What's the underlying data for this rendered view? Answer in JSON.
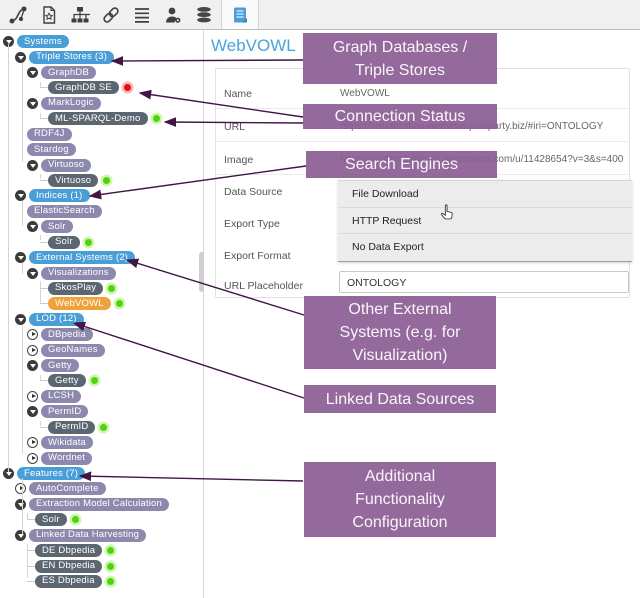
{
  "toolbar": {
    "icons": [
      {
        "name": "route-icon",
        "active": false
      },
      {
        "name": "file-star-icon",
        "active": false
      },
      {
        "name": "sitemap-icon",
        "active": false
      },
      {
        "name": "link-icon",
        "active": false
      },
      {
        "name": "list-icon",
        "active": false
      },
      {
        "name": "user-gear-icon",
        "active": false
      },
      {
        "name": "database-icon",
        "active": false
      },
      {
        "name": "server-blue-icon",
        "active": true
      }
    ]
  },
  "tree": {
    "rows": [
      {
        "label": "Systems",
        "depth": 0,
        "style": "blue",
        "expander": "expanded"
      },
      {
        "label": "Triple Stores (3)",
        "depth": 1,
        "style": "blue",
        "expander": "expanded"
      },
      {
        "label": "GraphDB",
        "depth": 2,
        "style": "purple",
        "expander": "expanded"
      },
      {
        "label": "GraphDB SE",
        "depth": 3,
        "style": "dark",
        "stub": true,
        "status": "red"
      },
      {
        "label": "MarkLogic",
        "depth": 2,
        "style": "purple",
        "expander": "expanded"
      },
      {
        "label": "ML-SPARQL-Demo",
        "depth": 3,
        "style": "dark",
        "stub": true,
        "status": "green"
      },
      {
        "label": "RDF4J",
        "depth": 2,
        "style": "purple"
      },
      {
        "label": "Stardog",
        "depth": 2,
        "style": "purple"
      },
      {
        "label": "Virtuoso",
        "depth": 2,
        "style": "purple",
        "expander": "expanded"
      },
      {
        "label": "Virtuoso",
        "depth": 3,
        "style": "dark",
        "stub": true,
        "status": "green"
      },
      {
        "label": "Indices (1)",
        "depth": 1,
        "style": "blue",
        "expander": "expanded"
      },
      {
        "label": "ElasticSearch",
        "depth": 2,
        "style": "purple"
      },
      {
        "label": "Solr",
        "depth": 2,
        "style": "purple",
        "expander": "expanded"
      },
      {
        "label": "Solr",
        "depth": 3,
        "style": "dark",
        "stub": true,
        "status": "green"
      },
      {
        "label": "External Systems (2)",
        "depth": 1,
        "style": "blue",
        "expander": "expanded"
      },
      {
        "label": "Visualizations",
        "depth": 2,
        "style": "purple",
        "expander": "expanded"
      },
      {
        "label": "SkosPlay",
        "depth": 3,
        "style": "dark",
        "stub": true,
        "status": "green"
      },
      {
        "label": "WebVOWL",
        "depth": 3,
        "style": "orange",
        "stub": true,
        "status": "green"
      },
      {
        "label": "LOD (12)",
        "depth": 1,
        "style": "blue",
        "expander": "expanded"
      },
      {
        "label": "DBpedia",
        "depth": 2,
        "style": "purple",
        "expander": "collapsed"
      },
      {
        "label": "GeoNames",
        "depth": 2,
        "style": "purple",
        "expander": "collapsed"
      },
      {
        "label": "Getty",
        "depth": 2,
        "style": "purple",
        "expander": "expanded"
      },
      {
        "label": "Getty",
        "depth": 3,
        "style": "dark",
        "stub": true,
        "status": "green"
      },
      {
        "label": "LCSH",
        "depth": 2,
        "style": "purple",
        "expander": "collapsed"
      },
      {
        "label": "PermID",
        "depth": 2,
        "style": "purple",
        "expander": "expanded"
      },
      {
        "label": "PermID",
        "depth": 3,
        "style": "dark",
        "stub": true,
        "status": "green"
      },
      {
        "label": "Wikidata",
        "depth": 2,
        "style": "purple",
        "expander": "collapsed"
      },
      {
        "label": "Wordnet",
        "depth": 2,
        "style": "purple",
        "expander": "collapsed"
      },
      {
        "label": "Features (7)",
        "depth": 0,
        "style": "blue",
        "expander": "expanded"
      },
      {
        "label": "AutoComplete",
        "depth": 1,
        "style": "purple",
        "expander": "collapsed"
      },
      {
        "label": "Extraction Model Calculation",
        "depth": 1,
        "style": "purple",
        "expander": "expanded"
      },
      {
        "label": "Solr",
        "depth": 2,
        "style": "dark",
        "stub": true,
        "status": "green"
      },
      {
        "label": "Linked Data Harvesting",
        "depth": 1,
        "style": "purple",
        "expander": "expanded"
      },
      {
        "label": "DE Dbpedia",
        "depth": 2,
        "style": "dark",
        "stub": true,
        "status": "green"
      },
      {
        "label": "EN Dbpedia",
        "depth": 2,
        "style": "dark",
        "stub": true,
        "status": "green"
      },
      {
        "label": "ES Dbpedia",
        "depth": 2,
        "style": "dark",
        "stub": true,
        "status": "green"
      }
    ]
  },
  "detail": {
    "title": "WebVOWL",
    "fields": [
      {
        "label": "Name",
        "value": "WebVOWL",
        "kind": "text",
        "separator": true
      },
      {
        "label": "URL",
        "value": "https://visualization-webvowl.poolparty.biz/#iri=ONTOLOGY",
        "kind": "text",
        "separator": true
      },
      {
        "label": "Image",
        "value": "https://avatars1.githubusercontent.com/u/11428654?v=3&s=400",
        "kind": "text",
        "separator": true
      },
      {
        "label": "Data Source",
        "value": "",
        "kind": "text",
        "separator": false
      },
      {
        "label": "Export Type",
        "value": "",
        "kind": "text",
        "separator": false
      },
      {
        "label": "Export Format",
        "value": "",
        "kind": "text",
        "separator": false
      },
      {
        "label": "URL Placeholder",
        "value": "ONTOLOGY",
        "kind": "input",
        "separator": false
      }
    ],
    "dropdown": {
      "options": [
        "File Download",
        "HTTP Request",
        "No Data Export"
      ],
      "hovered": "HTTP Request"
    }
  },
  "annotations": {
    "boxes": [
      {
        "id": "graph-databases",
        "lines": [
          "Graph Databases /",
          "Triple Stores"
        ]
      },
      {
        "id": "connection-status",
        "lines": [
          "Connection Status"
        ]
      },
      {
        "id": "search-engines",
        "lines": [
          "Search Engines"
        ]
      },
      {
        "id": "other-external-systems",
        "lines": [
          "Other External",
          "Systems (e.g. for",
          "Visualization)"
        ]
      },
      {
        "id": "linked-data-sources",
        "lines": [
          "Linked Data Sources"
        ]
      },
      {
        "id": "additional-functionality",
        "lines": [
          "Additional",
          "Functionality",
          "Configuration"
        ]
      }
    ]
  },
  "colors": {
    "pill_blue": "#4a9ed7",
    "pill_purple": "#8d88ae",
    "pill_dark": "#5c6670",
    "pill_orange": "#f0a13c",
    "annotation_purple": "#8a5d92",
    "arrow": "#3f1646",
    "status_green": "#4ed312",
    "status_red": "#e01212",
    "title_blue": "#4ba3d8"
  }
}
